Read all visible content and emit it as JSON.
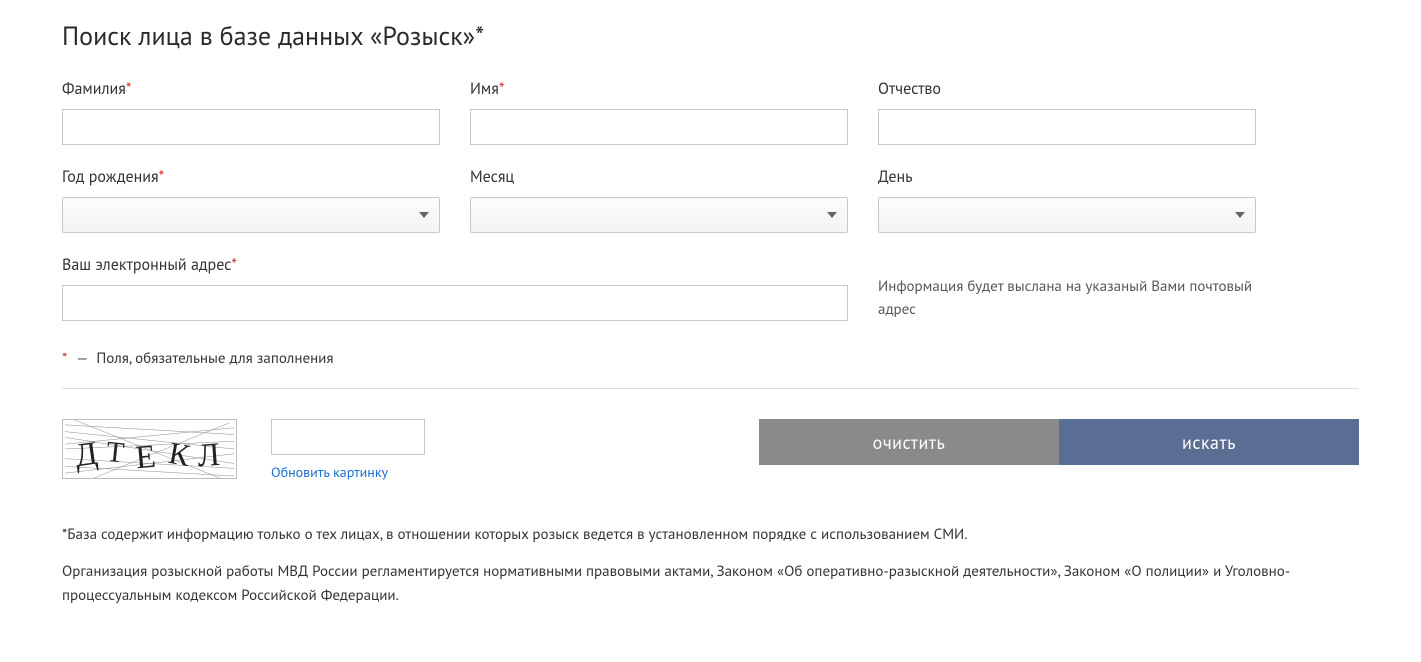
{
  "title": "Поиск лица в базе данных «Розыск»*",
  "fields": {
    "lastname": {
      "label": "Фамилия",
      "required": true
    },
    "firstname": {
      "label": "Имя",
      "required": true
    },
    "patronymic": {
      "label": "Отчество",
      "required": false
    },
    "year": {
      "label": "Год рождения",
      "required": true
    },
    "month": {
      "label": "Месяц",
      "required": false
    },
    "day": {
      "label": "День",
      "required": false
    },
    "email": {
      "label": "Ваш электронный адрес",
      "required": true
    }
  },
  "email_info": "Информация будет выслана на указаный Вами почтовый адрес",
  "required_note": "Поля, обязательные для заполнения",
  "captcha": {
    "text": "ДТЕКЛ",
    "refresh": "Обновить картинку"
  },
  "buttons": {
    "clear": "очистить",
    "search": "искать"
  },
  "footnote1": "*База содержит информацию только о тех лицах, в отношении которых розыск ведется в установленном порядке с использованием СМИ.",
  "footnote2": "Организация розыскной работы МВД России регламентируется нормативными правовыми актами, Законом «Об оперативно-разыскной деятельности», Законом «О полиции» и Уголовно-процессуальным кодексом Российской Федерации."
}
